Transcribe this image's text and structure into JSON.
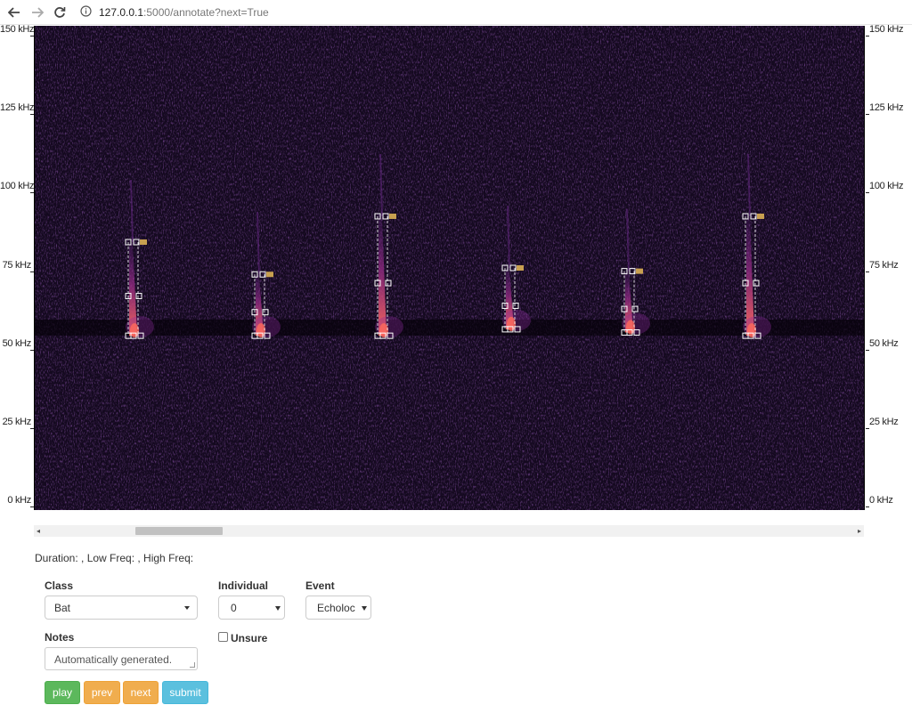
{
  "browser": {
    "url_host": "127.0.0.1",
    "url_path": ":5000/annotate?next=True"
  },
  "spectrogram": {
    "freq_labels": [
      "150 kHz",
      "125 kHz",
      "100 kHz",
      "75 kHz",
      "50 kHz",
      "25 kHz",
      "0 kHz"
    ],
    "colors": {
      "background": "#14091f",
      "call": "#c0306a",
      "call_core": "#ff6a5a",
      "box_handle": "#ffffff",
      "box_tag": "#c8a050"
    },
    "calls_low_khz": [
      54,
      54,
      54,
      56,
      55,
      54
    ],
    "calls_high_khz": [
      83,
      73,
      91,
      75,
      74,
      91
    ]
  },
  "info": {
    "text": "Duration: , Low Freq: , High Freq:"
  },
  "form": {
    "class_label": "Class",
    "class_value": "Bat",
    "individual_label": "Individual",
    "individual_value": "0",
    "event_label": "Event",
    "event_value": "Echoloc",
    "notes_label": "Notes",
    "notes_value": "Automatically generated.",
    "unsure_label": "Unsure",
    "unsure_checked": false
  },
  "buttons": {
    "play": "play",
    "prev": "prev",
    "next": "next",
    "submit": "submit"
  }
}
